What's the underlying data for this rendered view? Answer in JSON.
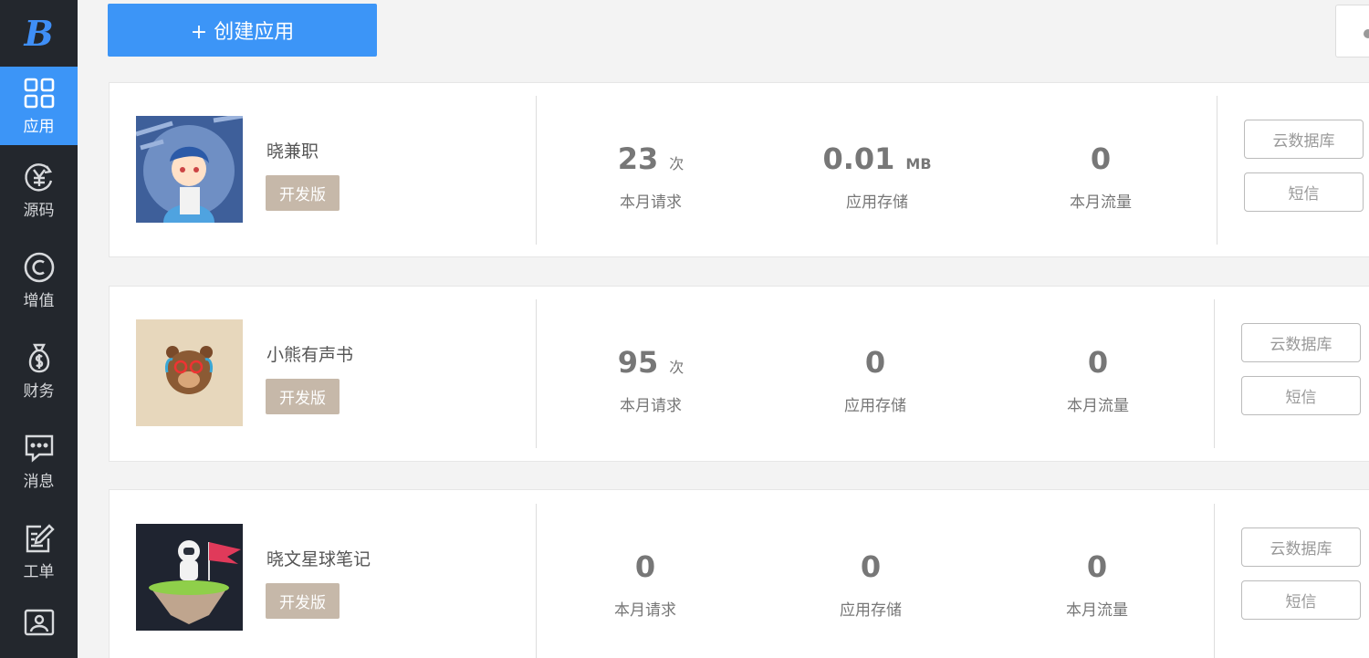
{
  "sidebar": {
    "logo": "B",
    "items": [
      {
        "label": "应用",
        "icon": "grid-icon"
      },
      {
        "label": "源码",
        "icon": "yuan-cycle-icon"
      },
      {
        "label": "增值",
        "icon": "copyright-icon"
      },
      {
        "label": "财务",
        "icon": "money-bag-icon"
      },
      {
        "label": "消息",
        "icon": "chat-icon"
      },
      {
        "label": "工单",
        "icon": "edit-icon"
      },
      {
        "label": "",
        "icon": "image-icon"
      }
    ]
  },
  "create_button": "+ 创建应用",
  "apps": [
    {
      "name": "晓兼职",
      "badge": "开发版",
      "requests": {
        "value": "23",
        "unit": "次",
        "label": "本月请求"
      },
      "storage": {
        "value": "0.01",
        "unit": "MB",
        "label": "应用存储"
      },
      "traffic": {
        "value": "0",
        "label": "本月流量"
      },
      "btn_db": "云数据库",
      "btn_sms": "短信"
    },
    {
      "name": "小熊有声书",
      "badge": "开发版",
      "requests": {
        "value": "95",
        "unit": "次",
        "label": "本月请求"
      },
      "storage": {
        "value": "0",
        "label": "应用存储"
      },
      "traffic": {
        "value": "0",
        "label": "本月流量"
      },
      "btn_db": "云数据库",
      "btn_sms": "短信"
    },
    {
      "name": "晓文星球笔记",
      "badge": "开发版",
      "requests": {
        "value": "0",
        "label": "本月请求"
      },
      "storage": {
        "value": "0",
        "label": "应用存储"
      },
      "traffic": {
        "value": "0",
        "label": "本月流量"
      },
      "btn_db": "云数据库",
      "btn_sms": "短信"
    }
  ],
  "colors": {
    "accent": "#3c95f7",
    "sidebar_bg": "#23272d",
    "badge_bg": "#c6b8a9"
  }
}
